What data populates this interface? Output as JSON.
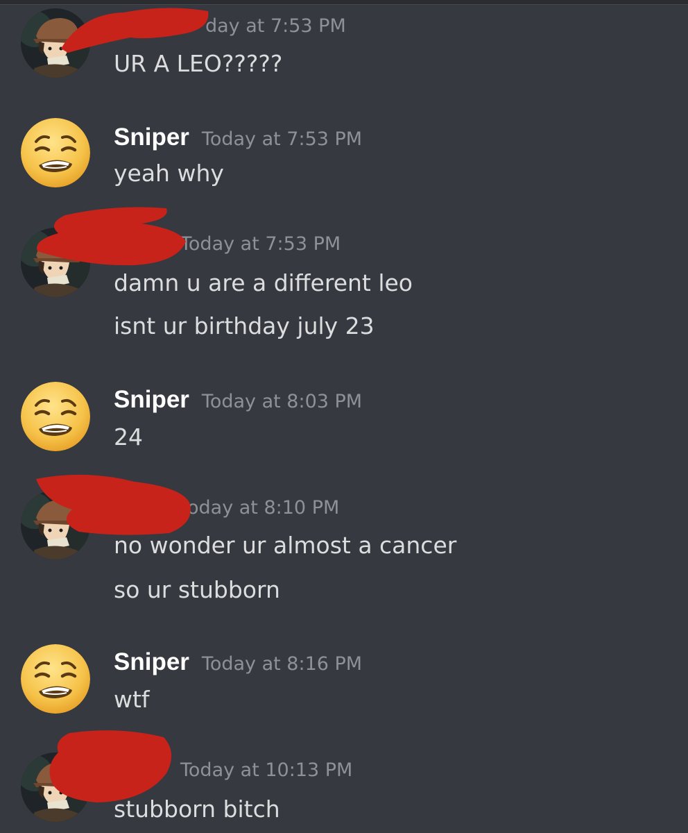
{
  "colors": {
    "background": "#36393f",
    "username": "#ffffff",
    "timestamp": "#8e9297",
    "message_text": "#dcddde",
    "redaction": "#c8231b"
  },
  "messages": [
    {
      "author": "",
      "avatar": "anime-boy-avatar-icon",
      "timestamp_visible": "day at 7:53 PM",
      "lines": [
        "UR A LEO?????"
      ]
    },
    {
      "author": "Sniper",
      "avatar": "weary-face-emoji-avatar-icon",
      "timestamp_visible": "Today at 7:53 PM",
      "lines": [
        "yeah why"
      ]
    },
    {
      "author": "",
      "avatar": "anime-boy-avatar-icon",
      "timestamp_visible": "Today at 7:53 PM",
      "lines": [
        "damn u are a different leo",
        "isnt ur birthday july 23"
      ]
    },
    {
      "author": "Sniper",
      "avatar": "weary-face-emoji-avatar-icon",
      "timestamp_visible": "Today at 8:03 PM",
      "lines": [
        "24"
      ]
    },
    {
      "author": "",
      "avatar": "anime-boy-avatar-icon",
      "timestamp_visible": "oday at 8:10 PM",
      "lines": [
        "no wonder ur almost a cancer",
        "so ur stubborn"
      ]
    },
    {
      "author": "Sniper",
      "avatar": "weary-face-emoji-avatar-icon",
      "timestamp_visible": "Today at 8:16 PM",
      "lines": [
        "wtf"
      ]
    },
    {
      "author": "",
      "avatar": "anime-boy-avatar-icon",
      "timestamp_visible": "Today at 10:13 PM",
      "lines": [
        "stubborn bitch"
      ]
    }
  ]
}
